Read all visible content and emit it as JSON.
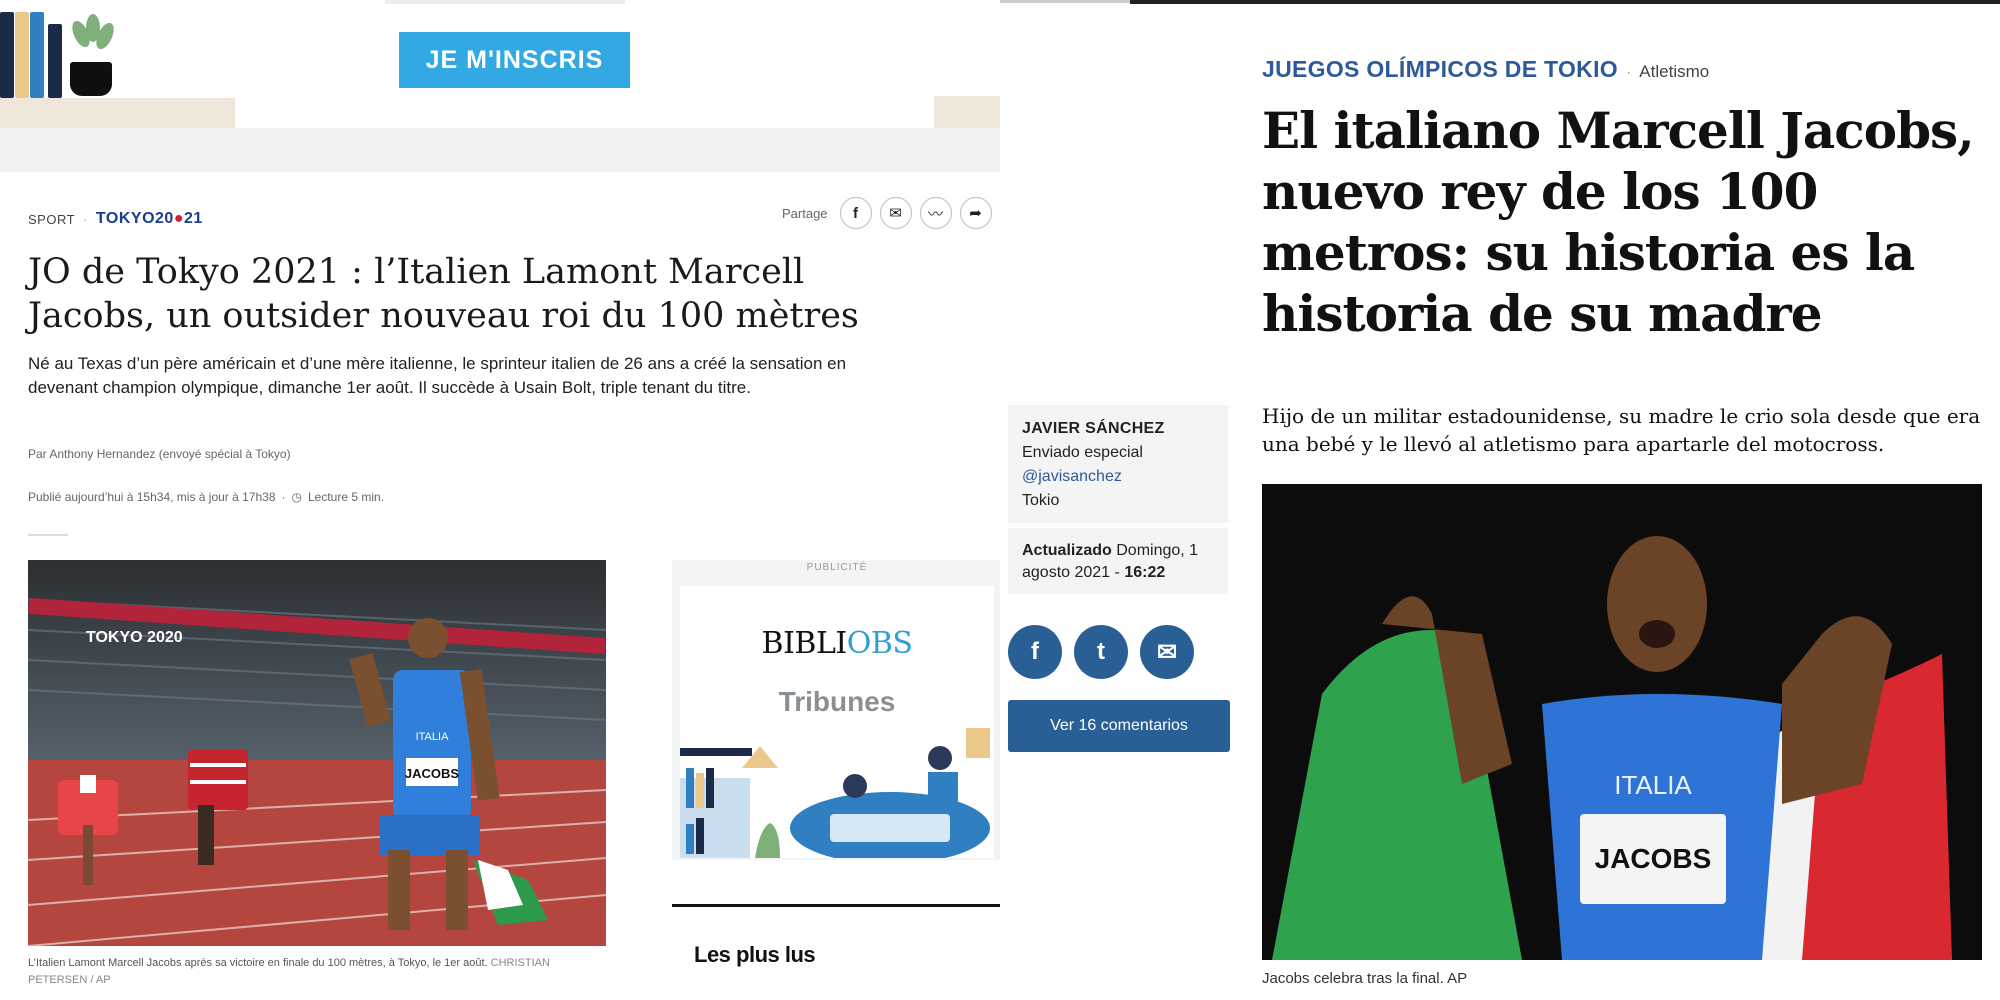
{
  "left": {
    "promo": {
      "signup_label": "JE M'INSCRIS"
    },
    "kicker": {
      "section": "SPORT",
      "event_logo_prefix": "TOKYO",
      "event_logo_year_a": "20",
      "event_logo_year_b": "21"
    },
    "share": {
      "label": "Partage",
      "icons": [
        "facebook-icon",
        "mail-icon",
        "messenger-icon",
        "share-arrow-icon"
      ]
    },
    "article": {
      "title": "JO de Tokyo 2021 : l’Italien Lamont Marcell Jacobs, un outsider nouveau roi du 100 mètres",
      "lead": "Né au Texas d’un père américain et d’une mère italienne, le sprinteur italien de 26 ans a créé la sensation en devenant champion olympique, dimanche 1er août. Il succède à Usain Bolt, triple tenant du titre.",
      "byline": "Par Anthony Hernandez (envoyé spécial à Tokyo)",
      "date": "Publié aujourd’hui à 15h34, mis à jour à 17h38",
      "reading_time": "Lecture 5 min.",
      "photo": {
        "stadium_sign": "TOKYO 2020",
        "bib": "JACOBS",
        "jersey": "ITALIA"
      },
      "caption": "L’Italien Lamont Marcell Jacobs après sa victoire en finale du 100 mètres, à Tokyo, le 1er août.",
      "credit": "CHRISTIAN PETERSEN / AP"
    },
    "ad": {
      "label": "PUBLICITÉ",
      "brand_a": "BIBLI",
      "brand_b": "OBS",
      "tagline": "Tribunes"
    },
    "most_read": "Les plus lus"
  },
  "right": {
    "section": "JUEGOS OLÍMPICOS DE TOKIO",
    "subsection": "Atletismo",
    "title": "El italiano Marcell Jacobs, nuevo rey de los 100 metros: su historia es la historia de su madre",
    "lead": "Hijo de un militar estadounidense, su madre le crio sola desde que era una bebé y le llevó al atletismo para apartarle del motocross.",
    "author": {
      "name": "JAVIER SÁNCHEZ",
      "role": "Enviado especial",
      "handle": "@javisanchez",
      "location": "Tokio"
    },
    "updated": {
      "label": "Actualizado",
      "date": "Domingo, 1 agosto 2021 -",
      "time": "16:22"
    },
    "social": [
      "f",
      "t",
      "✉"
    ],
    "comments_label": "Ver 16 comentarios",
    "photo": {
      "jersey": "ITALIA",
      "bib": "JACOBS"
    },
    "caption": "Jacobs celebra tras la final. AP"
  },
  "colors": {
    "signup_blue": "#33a9e3",
    "el_mundo_blue": "#2a5f96",
    "tokyo_red": "#d0202e",
    "obs_blue": "#2f9fd6"
  }
}
